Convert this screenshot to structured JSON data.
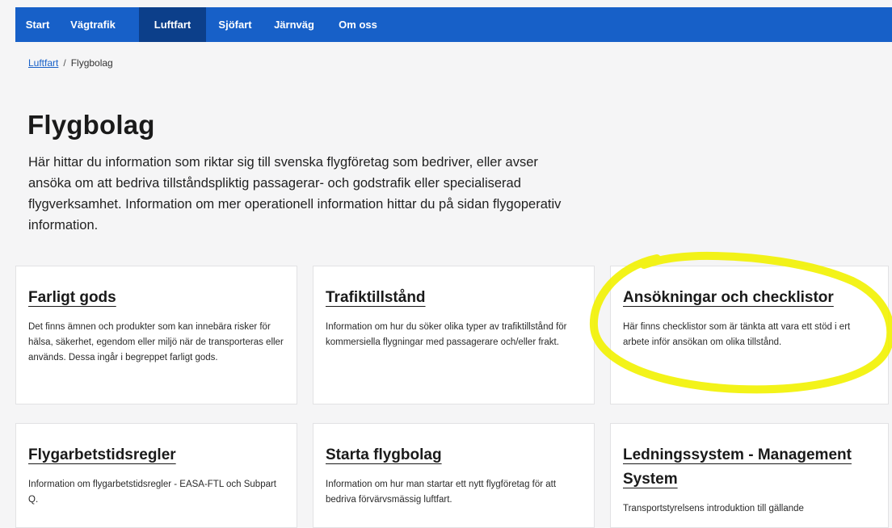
{
  "nav": {
    "items": [
      {
        "label": "Start"
      },
      {
        "label": "Vägtrafik"
      },
      {
        "label": "Luftfart"
      },
      {
        "label": "Sjöfart"
      },
      {
        "label": "Järnväg"
      },
      {
        "label": "Om oss"
      }
    ],
    "active": "Luftfart"
  },
  "breadcrumb": {
    "parent": "Luftfart",
    "separator": "/",
    "current": "Flygbolag"
  },
  "page": {
    "title": "Flygbolag",
    "lead": "Här hittar du information som riktar sig till svenska flygföretag som bedriver, eller avser ansöka om att bedriva tillståndspliktig passagerar- och godstrafik eller specialiserad flygverksamhet. Information om mer operationell information hittar du på sidan flygoperativ information."
  },
  "cards": [
    {
      "title": "Farligt gods",
      "text": "Det finns ämnen och produkter som kan innebära risker för hälsa, säkerhet, egendom eller miljö när de transporteras eller används. Dessa ingår i begreppet farligt gods."
    },
    {
      "title": "Trafiktillstånd",
      "text": "Information om hur du söker olika typer av trafiktillstånd för kommersiella flygningar med passagerare och/eller frakt."
    },
    {
      "title": "Ansökningar och checklistor",
      "text": "Här finns checklistor som är tänkta att vara ett stöd i ert arbete inför ansökan om olika tillstånd."
    },
    {
      "title": "Flygarbetstidsregler",
      "text": "Information om flygarbetstidsregler - EASA-FTL och Subpart Q."
    },
    {
      "title": "Starta flygbolag",
      "text": "Information om hur man startar ett nytt flygföretag för att bedriva förvärvsmässig luftfart."
    },
    {
      "title": "Ledningssystem - Management System",
      "text": "Transportstyrelsens introduktion till gällande"
    }
  ],
  "colors": {
    "nav_bg": "#1760c8",
    "nav_active_bg": "#0c3f8a",
    "page_bg": "#f5f5f6",
    "highlight": "#f2f200"
  }
}
